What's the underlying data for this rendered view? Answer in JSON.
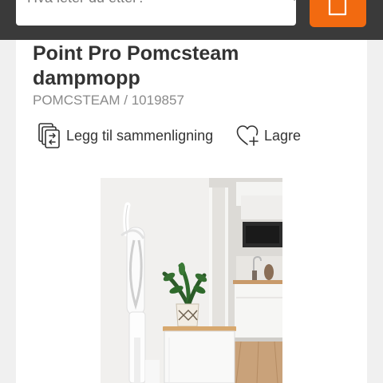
{
  "header": {
    "search": {
      "placeholder": "Hva leter du etter?"
    },
    "icons": {
      "search": "search-icon",
      "cart": "cart-icon"
    },
    "colors": {
      "bar": "#3a3a3a",
      "accent": "#f26a10"
    }
  },
  "product": {
    "title": "Point Pro Pomcsteam dampmopp",
    "subtitle": "POMCSTEAM / 1019857",
    "actions": {
      "compare_label": "Legg til sammenligning",
      "save_label": "Lagre"
    },
    "icons": {
      "compare": "compare-icon",
      "save": "heart-plus-icon"
    },
    "image": "product-photo"
  }
}
